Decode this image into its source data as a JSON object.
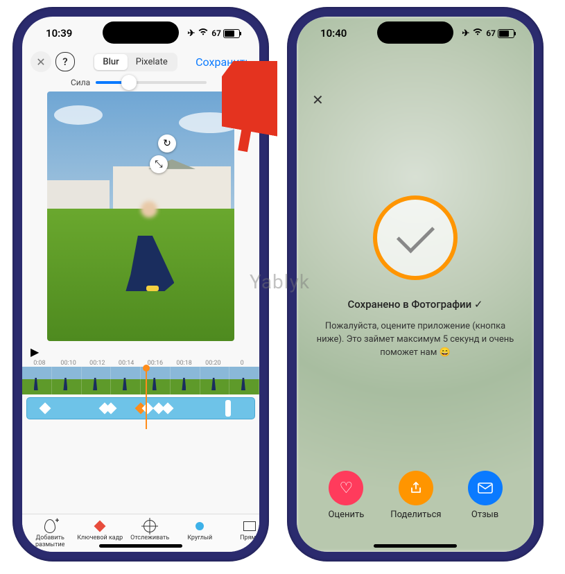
{
  "watermark": "Yablyk",
  "phone1": {
    "status": {
      "time": "10:39",
      "battery": "67"
    },
    "topbar": {
      "segment": {
        "blur": "Blur",
        "pixelate": "Pixelate"
      },
      "save": "Сохранить"
    },
    "slider": {
      "label": "Сила",
      "value_pct": 30
    },
    "timeline": {
      "codes": [
        "0:08",
        "00:10",
        "00:12",
        "00:14",
        "00:16",
        "00:18",
        "00:20",
        "0"
      ],
      "keyframe_positions_pct": [
        8,
        34,
        37,
        50,
        53,
        58,
        62
      ]
    },
    "toolbar": {
      "items": [
        {
          "label": "Добавить\nразмытие",
          "icon": "add-blur"
        },
        {
          "label": "Ключевой кадр",
          "icon": "keyframe"
        },
        {
          "label": "Отслеживать",
          "icon": "track"
        },
        {
          "label": "Круглый",
          "icon": "round",
          "selected": true
        },
        {
          "label": "Прямо",
          "icon": "rect"
        }
      ]
    }
  },
  "phone2": {
    "status": {
      "time": "10:40",
      "battery": "67"
    },
    "saved_title": "Сохранено в Фотографии ✓",
    "saved_desc": "Пожалуйста, оцените приложение (кнопка ниже). Это займет максимум 5 секунд и очень поможет нам 😄",
    "actions": {
      "rate": "Оценить",
      "share": "Поделиться",
      "feedback": "Отзыв"
    }
  }
}
